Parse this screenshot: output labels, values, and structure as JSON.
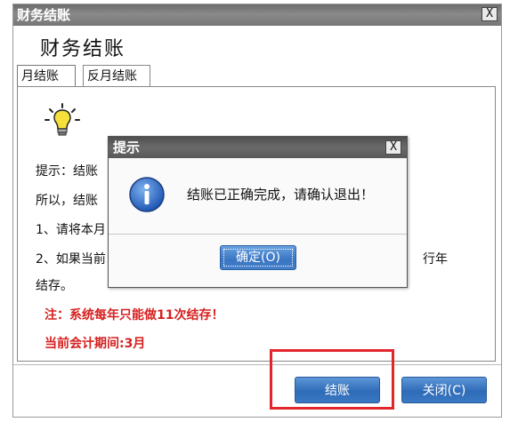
{
  "window": {
    "title": "财务结账",
    "close_label": "X",
    "heading": "财务结账",
    "tabs": [
      {
        "label": "月结账",
        "active": true
      },
      {
        "label": "反月结账",
        "active": false
      }
    ],
    "body_lines": [
      "提示：结账",
      "所以，结账",
      "1、请将本月",
      "2、如果当前",
      "结存。"
    ],
    "body_tail": "行年",
    "note": "注：系统每年只能做11次结存！",
    "current_period": "当前会计期间:3月",
    "buttons": {
      "close_books": "结账",
      "close": "关闭(C)"
    }
  },
  "dialog": {
    "title": "提示",
    "close_label": "X",
    "message": "结账已正确完成，请确认退出！",
    "ok_label": "确定(O)"
  },
  "colors": {
    "accent_button": "#2f6cb8",
    "titlebar": "#777777",
    "highlight": "#e3262c",
    "note_text": "#d62020"
  }
}
